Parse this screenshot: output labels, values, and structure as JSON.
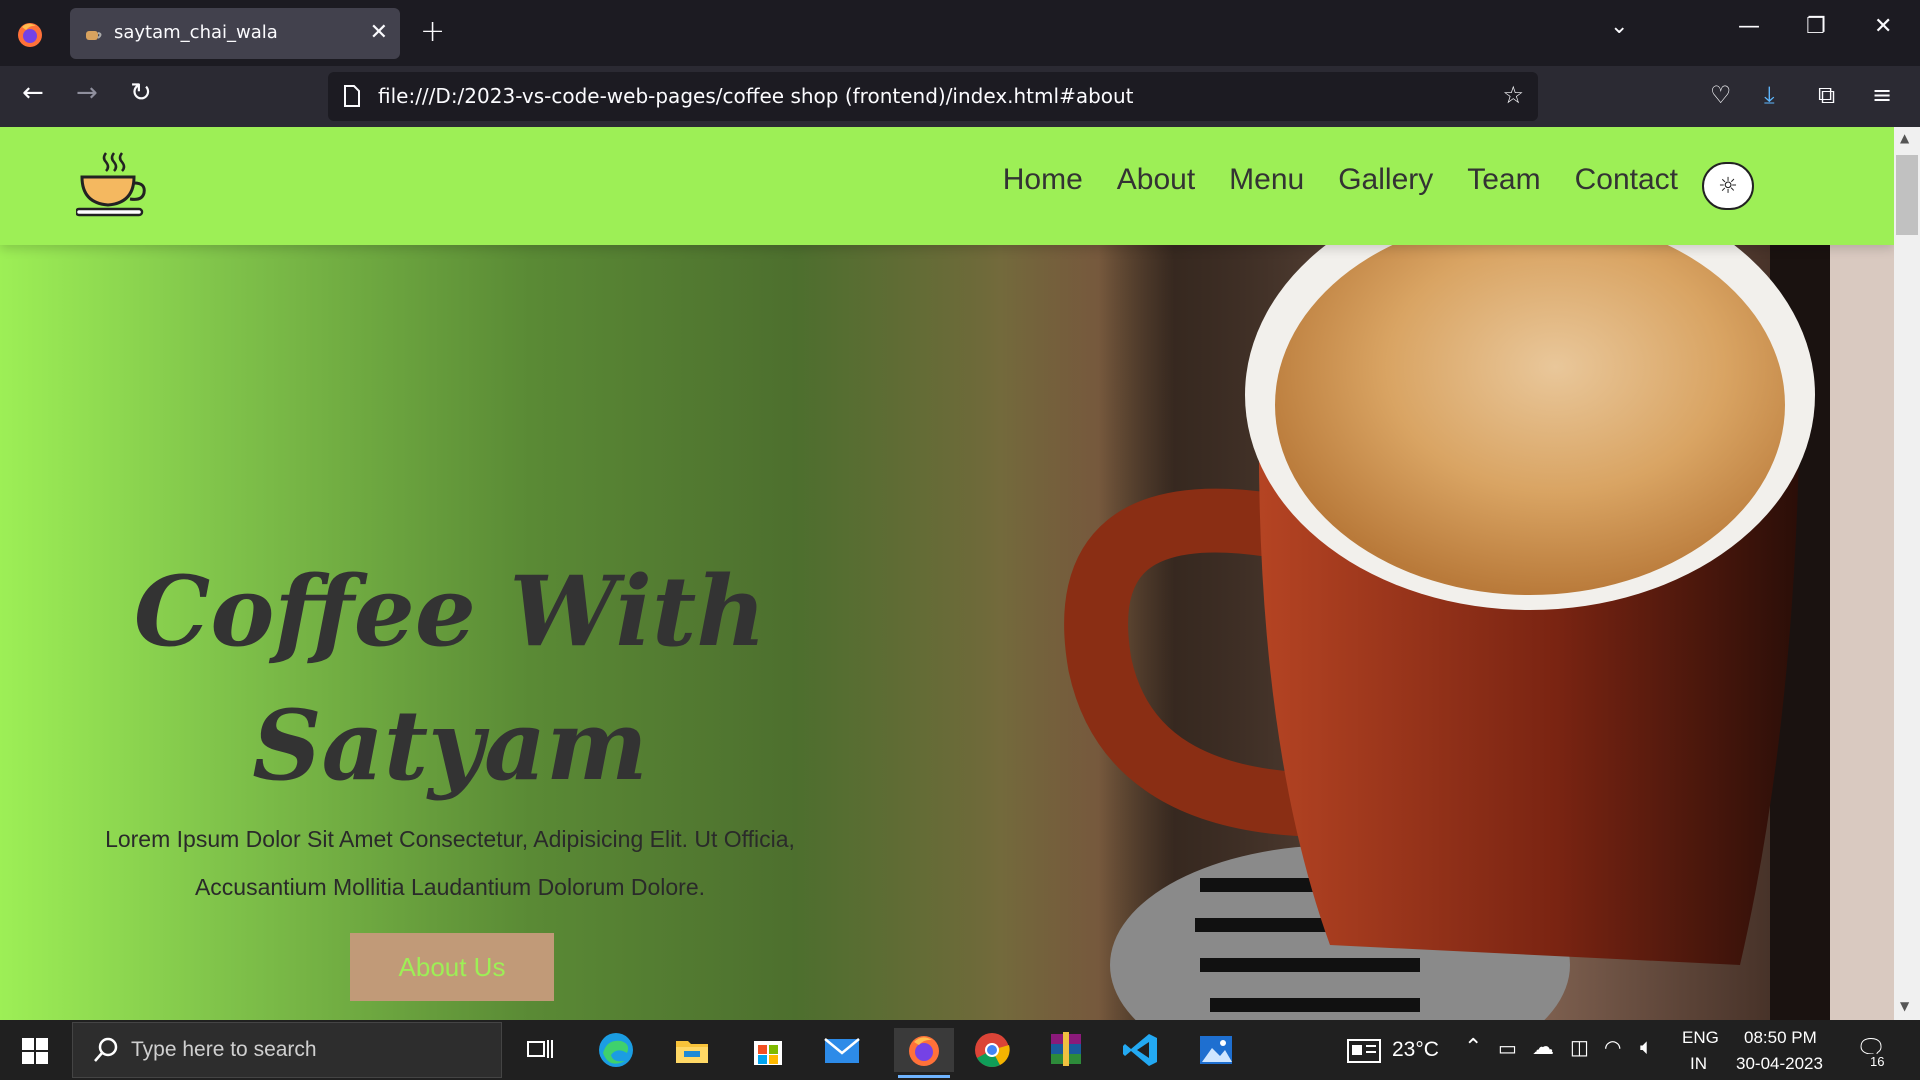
{
  "browser": {
    "tab_title": "saytam_chai_wala",
    "url": "file:///D:/2023-vs-code-web-pages/coffee shop (frontend)/index.html#about"
  },
  "site": {
    "nav": [
      "Home",
      "About",
      "Menu",
      "Gallery",
      "Team",
      "Contact"
    ],
    "hero_title_line1": "Coffee With",
    "hero_title_line2": "Satyam",
    "hero_text_line1": "Lorem Ipsum Dolor Sit Amet Consectetur, Adipisicing Elit. Ut Officia,",
    "hero_text_line2": "Accusantium Mollitia Laudantium Dolorum Dolore.",
    "cta_label": "About Us"
  },
  "taskbar": {
    "search_placeholder": "Type here to search",
    "temperature": "23°C",
    "lang1": "ENG",
    "lang2": "IN",
    "time": "08:50 PM",
    "date": "30-04-2023",
    "notifications": "16"
  },
  "colors": {
    "site_bg": "#9def56",
    "cta_bg": "#c19a78",
    "chrome_dark": "#1c1b22"
  }
}
